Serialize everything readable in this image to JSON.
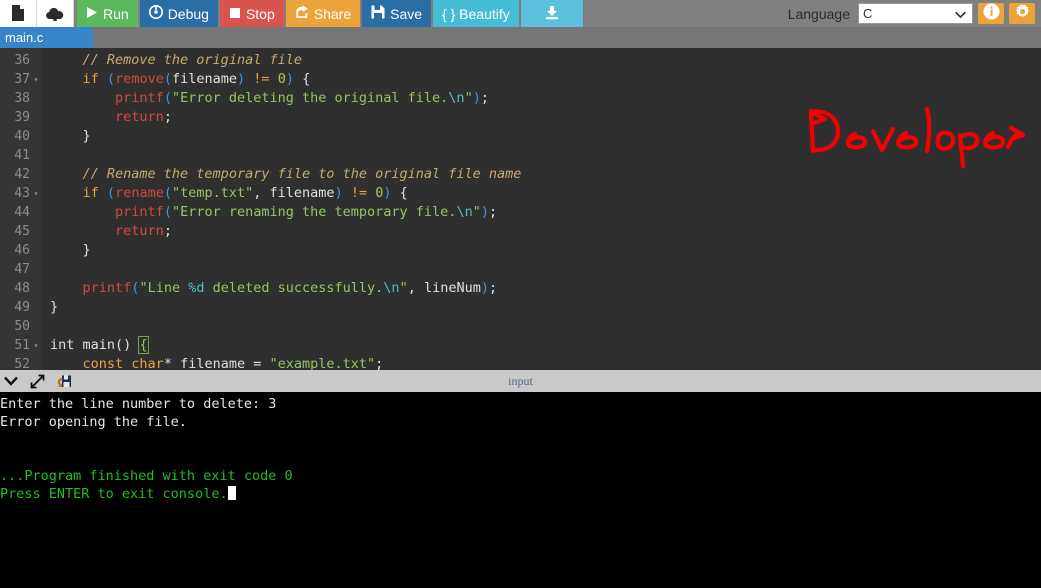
{
  "toolbar": {
    "new_file_icon": "document-icon",
    "upload_icon": "cloud-upload-icon",
    "buttons": [
      {
        "id": "run",
        "label": "Run",
        "icon": "play-icon",
        "color": "#5cb85c"
      },
      {
        "id": "debug",
        "label": "Debug",
        "icon": "debug-icon",
        "color": "#2a6ea6"
      },
      {
        "id": "stop",
        "label": "Stop",
        "icon": "square-icon",
        "color": "#d9534f"
      },
      {
        "id": "share",
        "label": "Share",
        "icon": "share-icon",
        "color": "#eda33b"
      },
      {
        "id": "save",
        "label": "Save",
        "icon": "floppy-icon",
        "color": "#2a6ea6"
      },
      {
        "id": "beautify",
        "label": "{ } Beautify",
        "icon": "braces-icon",
        "color": "#45bdd6"
      },
      {
        "id": "download",
        "label": "",
        "icon": "download-icon",
        "color": "#5bc0de"
      }
    ],
    "language_label": "Language",
    "language_value": "C",
    "language_options": [
      "C"
    ],
    "info_icon": "info-icon",
    "settings_icon": "gear-icon"
  },
  "tabs": [
    {
      "label": "main.c",
      "active": true
    }
  ],
  "editor": {
    "first_line": 36,
    "lines": [
      {
        "n": 36,
        "fold": false,
        "indent": 1,
        "tokens": [
          {
            "t": "    ",
            "c": "c-pln"
          },
          {
            "t": "// Remove the original file",
            "c": "c-com"
          }
        ]
      },
      {
        "n": 37,
        "fold": true,
        "indent": 1,
        "tokens": [
          {
            "t": "    ",
            "c": "c-pln"
          },
          {
            "t": "if",
            "c": "c-kw"
          },
          {
            "t": " ",
            "c": "c-pln"
          },
          {
            "t": "(",
            "c": "c-par"
          },
          {
            "t": "remove",
            "c": "c-fn"
          },
          {
            "t": "(",
            "c": "c-par"
          },
          {
            "t": "filename",
            "c": "c-pln"
          },
          {
            "t": ")",
            "c": "c-par"
          },
          {
            "t": " ",
            "c": "c-pln"
          },
          {
            "t": "!=",
            "c": "c-op"
          },
          {
            "t": " ",
            "c": "c-pln"
          },
          {
            "t": "0",
            "c": "c-num"
          },
          {
            "t": ")",
            "c": "c-par"
          },
          {
            "t": " {",
            "c": "c-pln"
          }
        ]
      },
      {
        "n": 38,
        "fold": false,
        "indent": 2,
        "tokens": [
          {
            "t": "        ",
            "c": "c-pln"
          },
          {
            "t": "printf",
            "c": "c-fn"
          },
          {
            "t": "(",
            "c": "c-par"
          },
          {
            "t": "\"Error deleting the original file.",
            "c": "c-str"
          },
          {
            "t": "\\n",
            "c": "c-esc"
          },
          {
            "t": "\"",
            "c": "c-str"
          },
          {
            "t": ")",
            "c": "c-par"
          },
          {
            "t": ";",
            "c": "c-pln"
          }
        ]
      },
      {
        "n": 39,
        "fold": false,
        "indent": 2,
        "tokens": [
          {
            "t": "        ",
            "c": "c-pln"
          },
          {
            "t": "return",
            "c": "c-fn"
          },
          {
            "t": ";",
            "c": "c-pln"
          }
        ]
      },
      {
        "n": 40,
        "fold": false,
        "indent": 1,
        "tokens": [
          {
            "t": "    }",
            "c": "c-pln"
          }
        ]
      },
      {
        "n": 41,
        "fold": false,
        "indent": 0,
        "tokens": []
      },
      {
        "n": 42,
        "fold": false,
        "indent": 1,
        "tokens": [
          {
            "t": "    ",
            "c": "c-pln"
          },
          {
            "t": "// Rename the temporary file to the original file name",
            "c": "c-com"
          }
        ]
      },
      {
        "n": 43,
        "fold": true,
        "indent": 1,
        "tokens": [
          {
            "t": "    ",
            "c": "c-pln"
          },
          {
            "t": "if",
            "c": "c-kw"
          },
          {
            "t": " ",
            "c": "c-pln"
          },
          {
            "t": "(",
            "c": "c-par"
          },
          {
            "t": "rename",
            "c": "c-fn"
          },
          {
            "t": "(",
            "c": "c-par"
          },
          {
            "t": "\"temp.txt\"",
            "c": "c-str"
          },
          {
            "t": ", ",
            "c": "c-pln"
          },
          {
            "t": "filename",
            "c": "c-pln"
          },
          {
            "t": ")",
            "c": "c-par"
          },
          {
            "t": " ",
            "c": "c-pln"
          },
          {
            "t": "!=",
            "c": "c-op"
          },
          {
            "t": " ",
            "c": "c-pln"
          },
          {
            "t": "0",
            "c": "c-num"
          },
          {
            "t": ")",
            "c": "c-par"
          },
          {
            "t": " {",
            "c": "c-pln"
          }
        ]
      },
      {
        "n": 44,
        "fold": false,
        "indent": 2,
        "tokens": [
          {
            "t": "        ",
            "c": "c-pln"
          },
          {
            "t": "printf",
            "c": "c-fn"
          },
          {
            "t": "(",
            "c": "c-par"
          },
          {
            "t": "\"Error renaming the temporary file.",
            "c": "c-str"
          },
          {
            "t": "\\n",
            "c": "c-esc"
          },
          {
            "t": "\"",
            "c": "c-str"
          },
          {
            "t": ")",
            "c": "c-par"
          },
          {
            "t": ";",
            "c": "c-pln"
          }
        ]
      },
      {
        "n": 45,
        "fold": false,
        "indent": 2,
        "tokens": [
          {
            "t": "        ",
            "c": "c-pln"
          },
          {
            "t": "return",
            "c": "c-fn"
          },
          {
            "t": ";",
            "c": "c-pln"
          }
        ]
      },
      {
        "n": 46,
        "fold": false,
        "indent": 1,
        "tokens": [
          {
            "t": "    }",
            "c": "c-pln"
          }
        ]
      },
      {
        "n": 47,
        "fold": false,
        "indent": 0,
        "tokens": []
      },
      {
        "n": 48,
        "fold": false,
        "indent": 1,
        "tokens": [
          {
            "t": "    ",
            "c": "c-pln"
          },
          {
            "t": "printf",
            "c": "c-fn"
          },
          {
            "t": "(",
            "c": "c-par"
          },
          {
            "t": "\"Line ",
            "c": "c-str"
          },
          {
            "t": "%d",
            "c": "c-esc"
          },
          {
            "t": " deleted successfully.",
            "c": "c-str"
          },
          {
            "t": "\\n",
            "c": "c-esc"
          },
          {
            "t": "\"",
            "c": "c-str"
          },
          {
            "t": ", ",
            "c": "c-pln"
          },
          {
            "t": "lineNum",
            "c": "c-pln"
          },
          {
            "t": ")",
            "c": "c-par"
          },
          {
            "t": ";",
            "c": "c-pln"
          }
        ]
      },
      {
        "n": 49,
        "fold": false,
        "indent": 0,
        "tokens": [
          {
            "t": "}",
            "c": "c-pln"
          }
        ]
      },
      {
        "n": 50,
        "fold": false,
        "indent": 0,
        "tokens": []
      },
      {
        "n": 51,
        "fold": true,
        "indent": 0,
        "tokens": [
          {
            "t": "int",
            "c": "c-pln"
          },
          {
            "t": " ",
            "c": "c-pln"
          },
          {
            "t": "main",
            "c": "c-pln"
          },
          {
            "t": "()",
            "c": "c-pln"
          },
          {
            "t": " ",
            "c": "c-pln"
          },
          {
            "t": "{",
            "c": "c-brk-hl"
          }
        ]
      },
      {
        "n": 52,
        "fold": false,
        "indent": 1,
        "tokens": [
          {
            "t": "    ",
            "c": "c-pln"
          },
          {
            "t": "const",
            "c": "c-kw"
          },
          {
            "t": " ",
            "c": "c-pln"
          },
          {
            "t": "char",
            "c": "c-kw"
          },
          {
            "t": "* ",
            "c": "c-pln"
          },
          {
            "t": "filename",
            "c": "c-pln"
          },
          {
            "t": " = ",
            "c": "c-pln"
          },
          {
            "t": "\"example.txt\"",
            "c": "c-str"
          },
          {
            "t": ";",
            "c": "c-pln"
          }
        ]
      }
    ]
  },
  "annotation": {
    "text": "Developer",
    "color": "#f50000"
  },
  "console_bar": {
    "collapse_icon": "chevron-down-icon",
    "expand_icon": "expand-arrows-icon",
    "snapshot_icon": "save-snapshot-icon",
    "title": "input"
  },
  "console": {
    "lines": [
      {
        "text": "Enter the line number to delete: 3",
        "color": "white",
        "cursor": false
      },
      {
        "text": "Error opening the file.",
        "color": "white",
        "cursor": false
      },
      {
        "text": "",
        "color": "white",
        "cursor": false
      },
      {
        "text": "",
        "color": "white",
        "cursor": false
      },
      {
        "text": "...Program finished with exit code 0",
        "color": "green",
        "cursor": false
      },
      {
        "text": "Press ENTER to exit console.",
        "color": "green",
        "cursor": true
      }
    ]
  }
}
